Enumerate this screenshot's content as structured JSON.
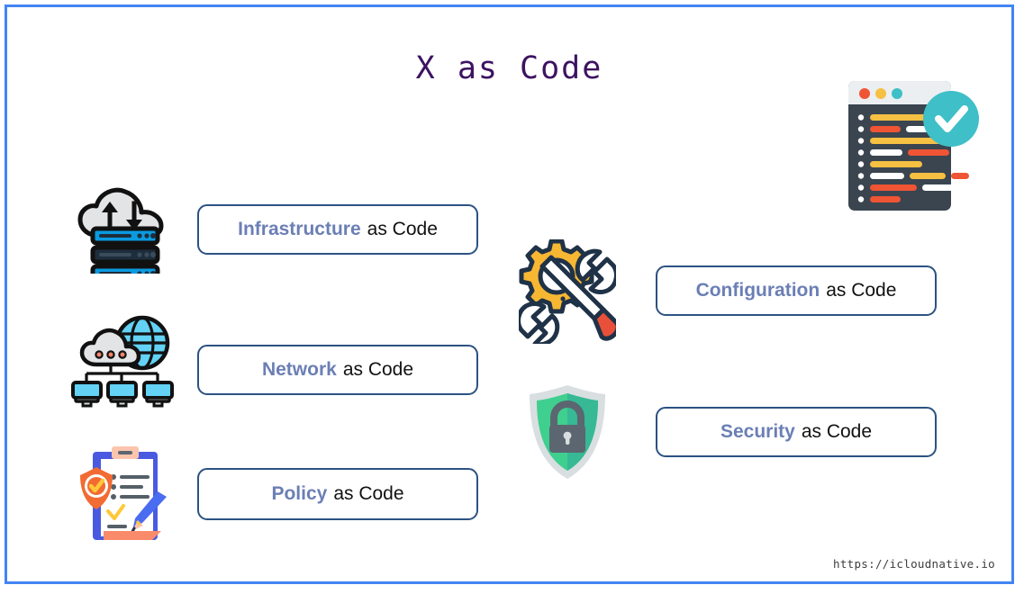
{
  "slide": {
    "title": "X as Code",
    "border_color": "#4285f4",
    "background": "#ffffff",
    "title_color": "#3c1361",
    "footer": "https://icloudnative.io"
  },
  "palette": {
    "pill_border": "#2c5282",
    "keyword_text": "#6b7fb5",
    "plain_text": "#111111",
    "server_blue": "#0a9ae0",
    "server_dark": "#1e2d3b",
    "globe_cyan": "#63d2f5",
    "gear_yellow": "#f7b733",
    "screwdriver_red": "#e8503a",
    "shield_green": "#3fcf8e",
    "shield_gray": "#d9dee1",
    "lock_gray": "#5b6670",
    "code_window_bg": "#3a4550",
    "code_titlebar": "#eceff1",
    "dot_red": "#ef5434",
    "dot_yellow": "#f6c042",
    "dot_teal": "#3fbfc7",
    "check_teal": "#3fbfc7",
    "clipboard_blue": "#4a5ae0",
    "clipboard_peach": "#f98b6a",
    "policy_shield_orange": "#f26b32",
    "policy_check_yellow": "#ffc839",
    "pen_blue": "#4a6cf0"
  },
  "items": [
    {
      "id": "infrastructure",
      "icon": "cloud-server-icon",
      "keyword": "Infrastructure",
      "suffix": "as Code",
      "column": "left"
    },
    {
      "id": "network",
      "icon": "cloud-globe-network-icon",
      "keyword": "Network",
      "suffix": "as Code",
      "column": "left"
    },
    {
      "id": "policy",
      "icon": "clipboard-shield-pen-icon",
      "keyword": "Policy",
      "suffix": "as Code",
      "column": "left"
    },
    {
      "id": "configuration",
      "icon": "gear-wrench-screwdriver-icon",
      "keyword": "Configuration",
      "suffix": "as Code",
      "column": "right"
    },
    {
      "id": "security",
      "icon": "shield-lock-icon",
      "keyword": "Security",
      "suffix": "as Code",
      "column": "right"
    }
  ],
  "decoration": {
    "code_window": {
      "icon": "code-window-check-icon",
      "titlebar_dots": [
        "#ef5434",
        "#f6c042",
        "#3fbfc7"
      ],
      "code_lines": [
        [
          {
            "c": "#f6c042",
            "w": 96
          }
        ],
        [
          {
            "c": "#ef5434",
            "w": 34
          },
          {
            "c": "#ffffff",
            "w": 50
          }
        ],
        [
          {
            "c": "#f6c042",
            "w": 96
          }
        ],
        [
          {
            "c": "#ffffff",
            "w": 36
          },
          {
            "c": "#ef5434",
            "w": 46
          },
          {
            "c": "#ffffff",
            "w": 28
          }
        ],
        [
          {
            "c": "#f6c042",
            "w": 58
          }
        ],
        [
          {
            "c": "#ffffff",
            "w": 38
          },
          {
            "c": "#f6c042",
            "w": 40
          },
          {
            "c": "#ef5434",
            "w": 20
          }
        ],
        [
          {
            "c": "#ef5434",
            "w": 52
          },
          {
            "c": "#ffffff",
            "w": 62
          }
        ],
        [
          {
            "c": "#ef5434",
            "w": 34
          }
        ]
      ],
      "check_mark": "✓"
    }
  }
}
